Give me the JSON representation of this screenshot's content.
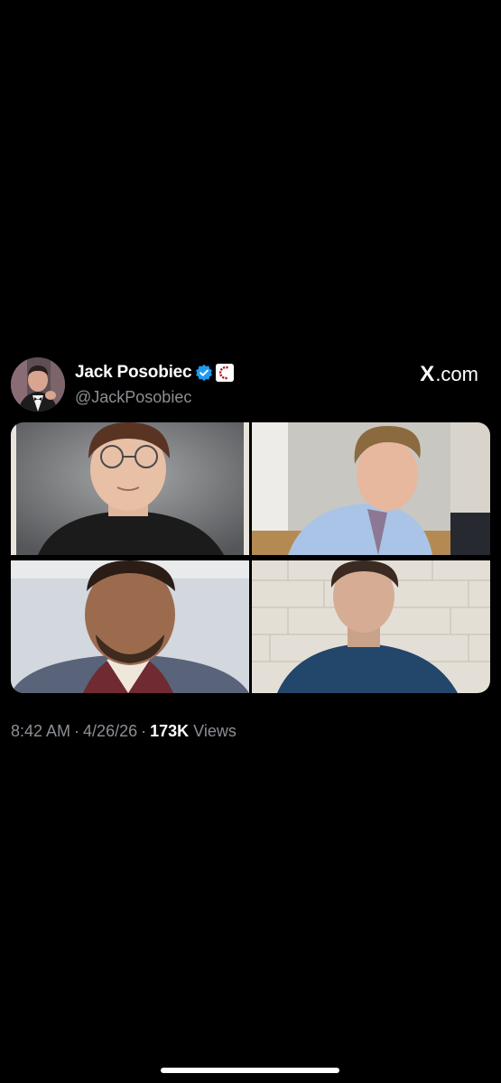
{
  "post": {
    "display_name": "Jack Posobiec",
    "handle": "@JackPosobiec",
    "site_label": ".com",
    "site_glyph": "X",
    "timestamp": "8:42 AM",
    "date": "4/26/26",
    "views_count": "173K",
    "views_label": "Views",
    "separator": "·"
  },
  "icons": {
    "verified": "verified-check-icon",
    "affiliate": "affiliate-badge-icon",
    "x_logo": "x-logo-icon"
  },
  "colors": {
    "background": "#000000",
    "verified_blue": "#1d9bf0",
    "secondary_text": "#8b8f94"
  }
}
